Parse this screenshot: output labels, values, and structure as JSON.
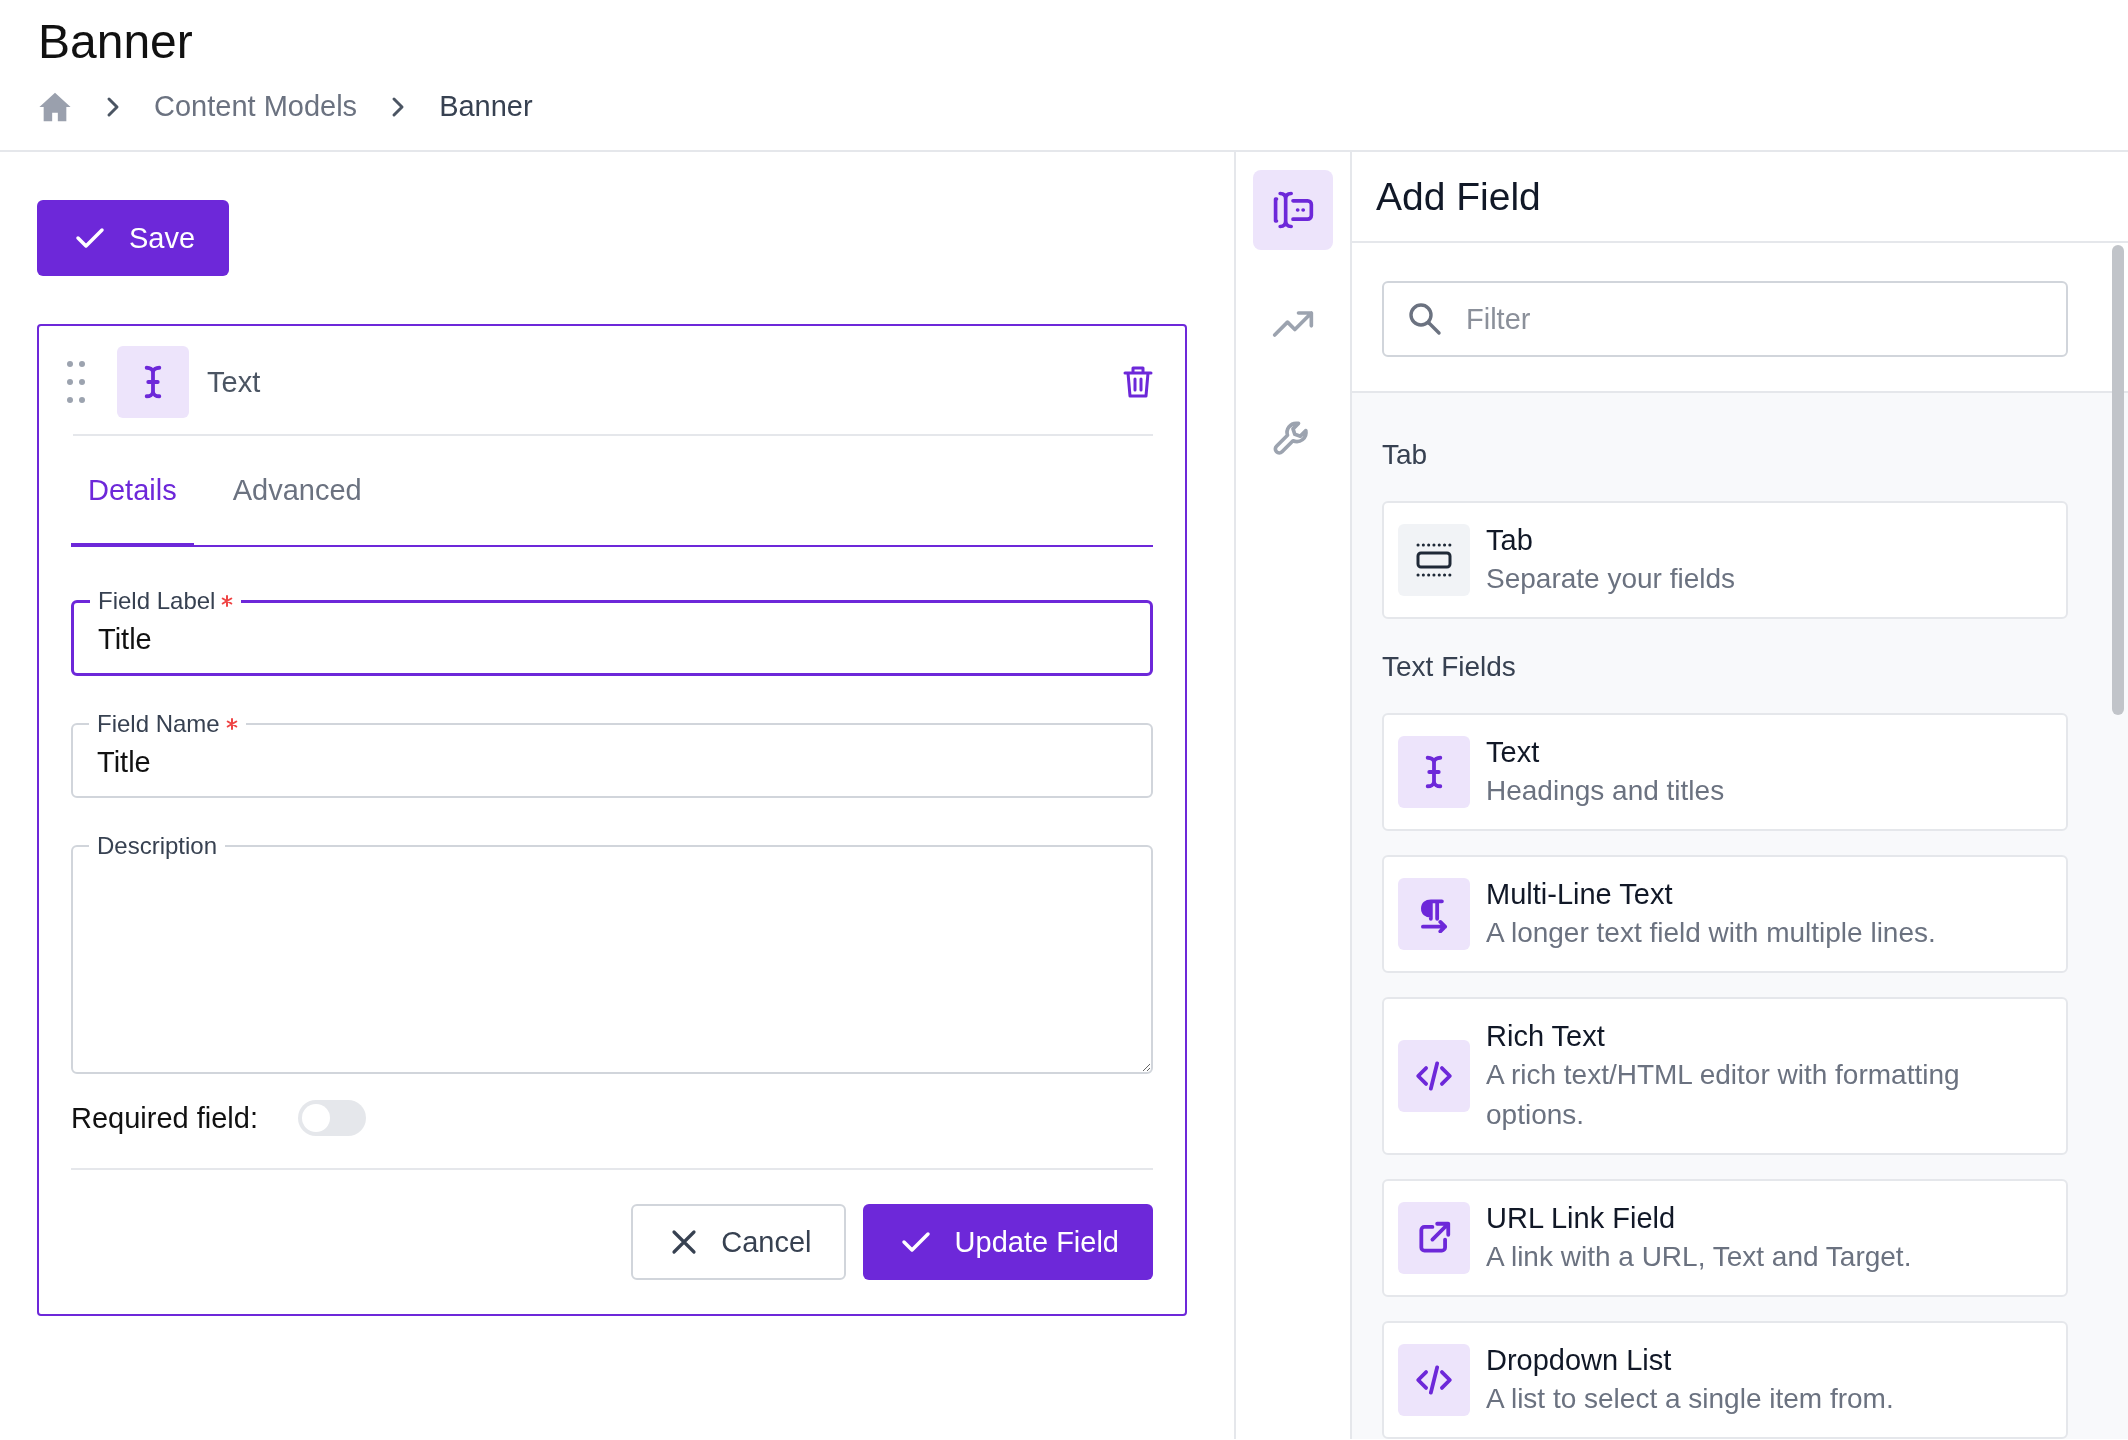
{
  "page": {
    "title": "Banner",
    "breadcrumbs": [
      {
        "kind": "home"
      },
      {
        "kind": "link",
        "label": "Content Models"
      },
      {
        "kind": "current",
        "label": "Banner"
      }
    ]
  },
  "save_button": {
    "label": "Save"
  },
  "field_card": {
    "type_label": "Text",
    "tabs": [
      {
        "label": "Details",
        "selected": true
      },
      {
        "label": "Advanced",
        "selected": false
      }
    ],
    "fields": [
      {
        "kind": "input",
        "label": "Field Label",
        "required": true,
        "value": "Title",
        "focused": true
      },
      {
        "kind": "input",
        "label": "Field Name",
        "required": true,
        "value": "Title",
        "focused": false
      },
      {
        "kind": "textarea",
        "label": "Description",
        "required": false,
        "focused": false
      }
    ],
    "required_toggle": {
      "label": "Required field:",
      "on": false
    },
    "buttons": [
      {
        "kind": "secondary",
        "label": "Cancel"
      },
      {
        "kind": "primary",
        "label": "Update Field"
      }
    ]
  },
  "rail": {
    "items": [
      {
        "kind": "fields",
        "selected": true
      },
      {
        "kind": "trend",
        "selected": false
      },
      {
        "kind": "wrench",
        "selected": false
      }
    ]
  },
  "add_field": {
    "title": "Add Field",
    "filter": {
      "placeholder": "Filter"
    },
    "groups": [
      {
        "title": "Tab",
        "items": [
          {
            "kind": "tab",
            "name": "Tab",
            "description": "Separate your fields"
          }
        ]
      },
      {
        "title": "Text Fields",
        "items": [
          {
            "kind": "text",
            "name": "Text",
            "description": "Headings and titles"
          },
          {
            "kind": "multiline",
            "name": "Multi-Line Text",
            "description": "A longer text field with multiple lines."
          },
          {
            "kind": "code",
            "name": "Rich Text",
            "description": "A rich text/HTML editor with formatting options."
          },
          {
            "kind": "link",
            "name": "URL Link Field",
            "description": "A link with a URL, Text and Target."
          },
          {
            "kind": "code",
            "name": "Dropdown List",
            "description": "A list to select a single item from."
          }
        ]
      }
    ]
  }
}
